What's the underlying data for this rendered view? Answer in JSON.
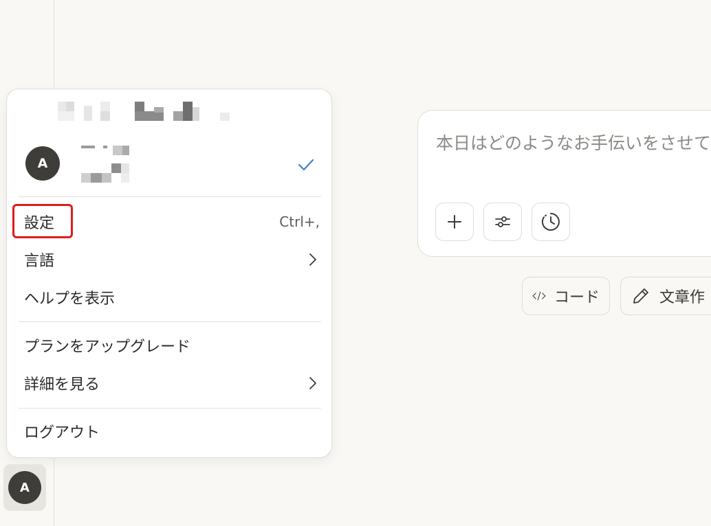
{
  "account_menu": {
    "avatar_letter": "A",
    "items": [
      {
        "label": "設定",
        "shortcut": "Ctrl+,"
      },
      {
        "label": "言語"
      },
      {
        "label": "ヘルプを表示"
      },
      {
        "label": "プランをアップグレード"
      },
      {
        "label": "詳細を見る"
      },
      {
        "label": "ログアウト"
      }
    ]
  },
  "sidebar": {
    "avatar_letter": "A"
  },
  "composer": {
    "placeholder": "本日はどのようなお手伝いをさせていた"
  },
  "chips": [
    {
      "label": "コード"
    },
    {
      "label": "文章作"
    }
  ],
  "colors": {
    "highlight": "#e01b1b",
    "check": "#3b82c4",
    "avatar_bg": "#3e3d39"
  }
}
